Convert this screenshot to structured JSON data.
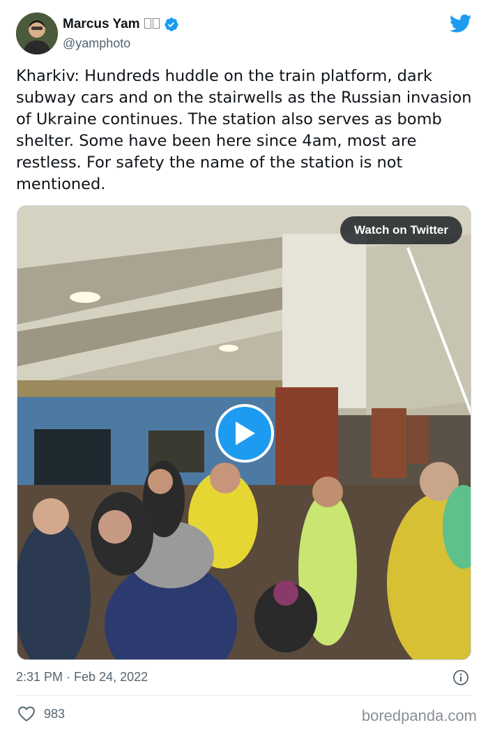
{
  "author": {
    "name": "Marcus Yam",
    "flag_emoji": "🇺🇦",
    "handle": "@yamphoto",
    "verified": true,
    "avatar_icon": "person-avatar"
  },
  "icons": {
    "brand": "twitter-bird-icon",
    "verified": "verified-badge-icon",
    "info": "info-icon",
    "like": "heart-icon",
    "play": "play-icon"
  },
  "colors": {
    "twitter_blue": "#1d9bf0",
    "text_primary": "#0f1419",
    "text_secondary": "#536471",
    "ukraine_blue": "#0057b7",
    "ukraine_yellow": "#ffd700"
  },
  "tweet": {
    "text": "Kharkiv: Hundreds huddle on the train platform, dark subway cars and on the stairwells as the Russian invasion of Ukraine continues. The station also serves as bomb shelter. Some have been here since 4am, most are restless. For safety the name of the station is not mentioned."
  },
  "media": {
    "watch_label": "Watch on Twitter"
  },
  "footer": {
    "timestamp": "2:31 PM · Feb 24, 2022",
    "like_count": "983"
  },
  "watermark": "boredpanda.com"
}
